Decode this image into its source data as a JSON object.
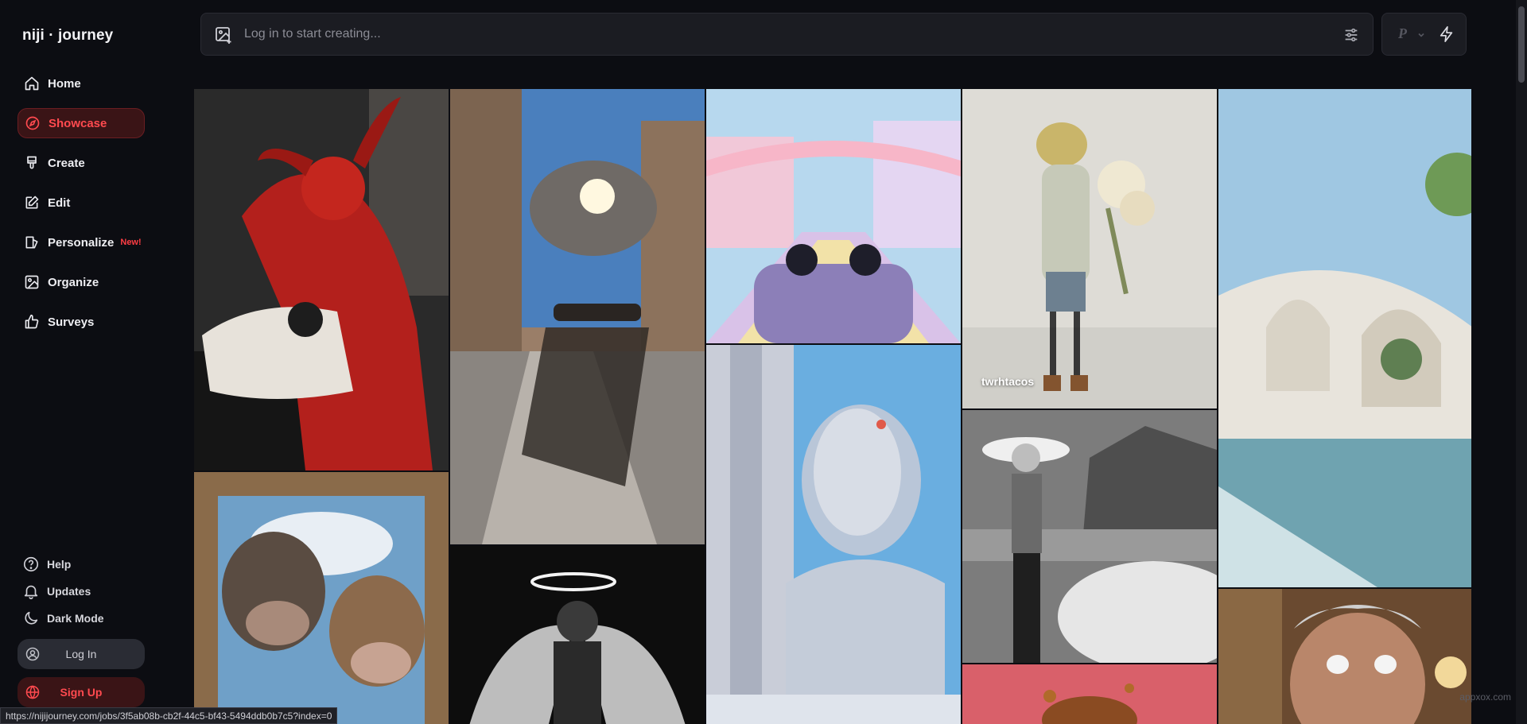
{
  "app": {
    "logo": "niji · journey"
  },
  "sidebar": {
    "items": [
      {
        "label": "Home"
      },
      {
        "label": "Showcase"
      },
      {
        "label": "Create"
      },
      {
        "label": "Edit"
      },
      {
        "label": "Personalize",
        "badge": "New!"
      },
      {
        "label": "Organize"
      },
      {
        "label": "Surveys"
      }
    ],
    "bottom": [
      {
        "label": "Help"
      },
      {
        "label": "Updates"
      },
      {
        "label": "Dark Mode"
      }
    ],
    "login_label": "Log In",
    "signup_label": "Sign Up"
  },
  "prompt": {
    "placeholder": "Log in to start creating..."
  },
  "controls": {
    "mode_letter": "P"
  },
  "gallery": {
    "tile_user": "twrhtacos"
  },
  "status": {
    "url": "https://nijijourney.com/jobs/3f5ab08b-cb2f-44c5-bf43-5494ddb0b7c5?index=0"
  },
  "watermark": "appxox.com",
  "colors": {
    "accent": "#ff4a4f",
    "background": "#0c0d12",
    "panel": "#1b1c22"
  }
}
